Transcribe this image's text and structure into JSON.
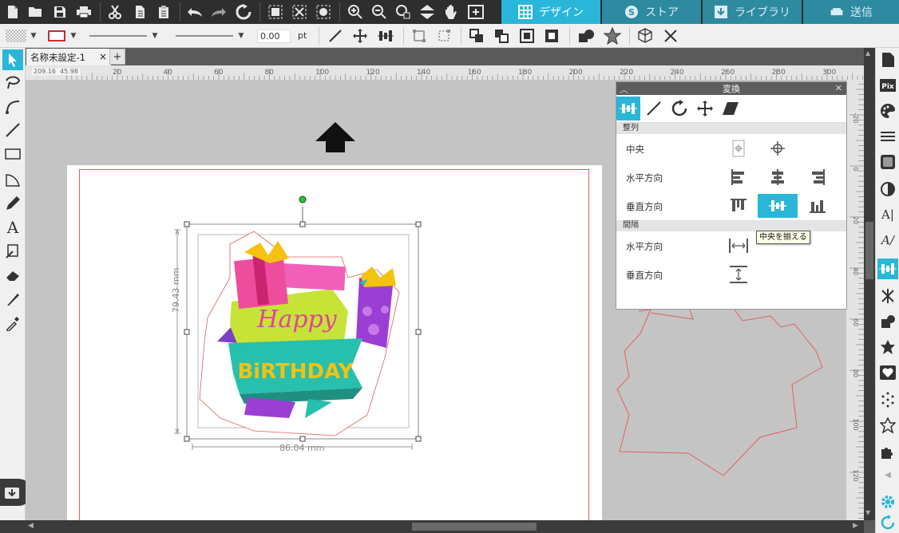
{
  "tabs": [
    {
      "label": "デザイン",
      "icon": "grid-icon",
      "active": true
    },
    {
      "label": "ストア",
      "icon": "store-s-icon",
      "active": false
    },
    {
      "label": "ライブラリ",
      "icon": "library-download-icon",
      "active": false
    },
    {
      "label": "送信",
      "icon": "cutter-icon",
      "active": false
    }
  ],
  "toolbar2": {
    "stroke_width": "0.00",
    "stroke_unit": "pt"
  },
  "document": {
    "tab_label": "名称未設定-1",
    "close_glyph": "×",
    "add_glyph": "+"
  },
  "ruler": {
    "coords_x": "209.16",
    "coords_y": "45.98",
    "h_ticks": [
      "20",
      "40",
      "60",
      "80",
      "100",
      "120",
      "140",
      "160",
      "180",
      "200",
      "220",
      "240",
      "260",
      "280",
      "300"
    ],
    "v_ticks": [
      "-20",
      "0",
      "20",
      "40",
      "60",
      "80",
      "100",
      "120"
    ]
  },
  "selection": {
    "height_label": "79.43 mm",
    "width_label": "86.04 mm"
  },
  "artwork": {
    "line1": "Happy",
    "line2": "BiRTHDAY"
  },
  "transform_panel": {
    "title": "変換",
    "section_align": "整列",
    "section_spacing": "間隔",
    "rows": {
      "center": "中央",
      "horizontal": "水平方向",
      "vertical": "垂直方向",
      "space_horizontal": "水平方向",
      "space_vertical": "垂直方向"
    },
    "tooltip": "中央を揃える"
  },
  "colors": {
    "accent": "#29b6d8",
    "toolbar_dark": "#2e2e2e",
    "cut_line": "#e06060"
  }
}
